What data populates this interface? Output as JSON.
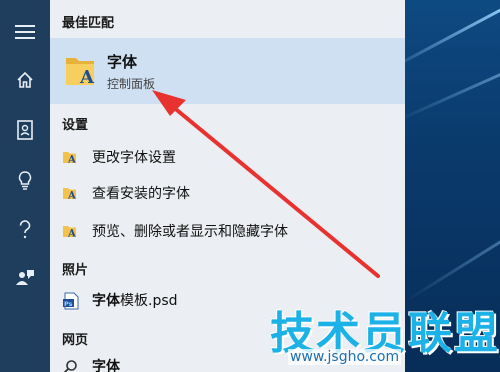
{
  "rail": {
    "icons": [
      "hamburger-menu-icon",
      "home-icon",
      "notebook-icon",
      "lightbulb-icon",
      "help-icon",
      "feedback-icon"
    ]
  },
  "sections": {
    "best_match": "最佳匹配",
    "settings": "设置",
    "photos": "照片",
    "web": "网页"
  },
  "best_match": {
    "title": "字体",
    "subtitle": "控制面板",
    "icon": "fonts-folder-icon"
  },
  "settings_items": [
    {
      "label": "更改字体设置",
      "icon": "fonts-settings-icon"
    },
    {
      "label": "查看安装的字体",
      "icon": "fonts-settings-icon"
    },
    {
      "label": "预览、删除或者显示和隐藏字体",
      "icon": "fonts-settings-icon"
    }
  ],
  "photos_item": {
    "label_bold": "字体",
    "label_rest": "模板.psd",
    "icon": "psd-file-icon"
  },
  "web_item": {
    "label": "字体",
    "icon": "search-icon"
  },
  "annotation": {
    "arrow_color": "#e8322f"
  },
  "watermark": {
    "main": "技术员联盟",
    "url": "www.jsgho.com"
  },
  "colors": {
    "rail": "#1f3d5c",
    "panel": "#ebeef2",
    "best_match_bg": "#cfe0f2",
    "watermark": "#1cb2e8"
  }
}
